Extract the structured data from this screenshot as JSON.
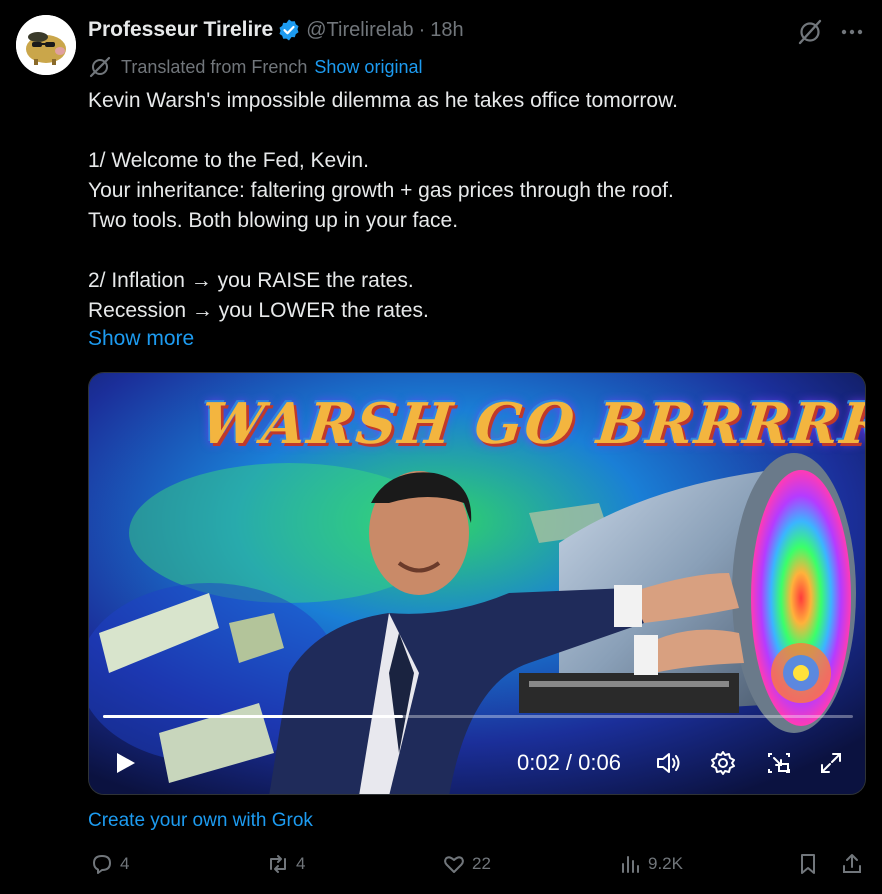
{
  "tweet": {
    "display_name": "Professeur Tirelire",
    "handle": "@Tirelirelab",
    "separator": "·",
    "time": "18h"
  },
  "translation": {
    "label": "Translated from French",
    "show_original": "Show original"
  },
  "body": {
    "lines": [
      "Kevin Warsh's impossible dilemma as he takes office tomorrow.",
      "",
      "1/ Welcome to the Fed, Kevin.",
      "Your inheritance: faltering growth + gas prices through the roof.",
      "Two tools. Both blowing up in your face.",
      "",
      "2/ Inflation → you RAISE the rates.",
      "Recession → you LOWER the rates."
    ],
    "show_more": "Show more"
  },
  "video": {
    "title_overlay": "WARSH GO BRRRRR",
    "time_readout": "0:02 / 0:06",
    "progress_fraction": 0.4
  },
  "grok_link": "Create your own with Grok",
  "actions": {
    "replies": "4",
    "reposts": "4",
    "likes": "22",
    "views": "9.2K"
  },
  "colors": {
    "accent": "#1d9bf0",
    "muted": "#71767b",
    "text": "#e7e9ea",
    "background": "#000000"
  },
  "icons": [
    "verified-badge-icon",
    "grok-icon",
    "more-icon",
    "translate-icon",
    "play-icon",
    "volume-icon",
    "settings-icon",
    "pip-icon",
    "fullscreen-icon",
    "reply-icon",
    "repost-icon",
    "like-icon",
    "views-icon",
    "bookmark-icon",
    "share-icon"
  ]
}
